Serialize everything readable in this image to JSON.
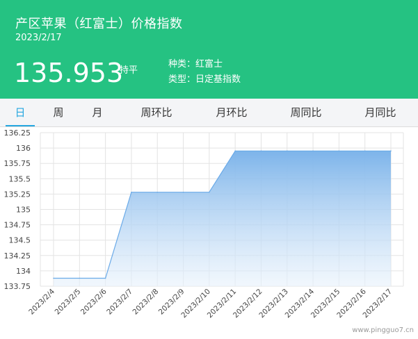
{
  "header": {
    "title": "产区苹果（红富士）价格指数",
    "date": "2023/2/17",
    "value": "135.953",
    "change": "持平",
    "variety_label": "种类：红富士",
    "type_label": "类型：日定基指数"
  },
  "tabs": [
    {
      "label": "日",
      "active": true
    },
    {
      "label": "周",
      "active": false
    },
    {
      "label": "月",
      "active": false
    },
    {
      "label": "周环比",
      "active": false
    },
    {
      "label": "月环比",
      "active": false
    },
    {
      "label": "周同比",
      "active": false
    },
    {
      "label": "月同比",
      "active": false
    }
  ],
  "watermark": "www.pingguo7.cn",
  "colors": {
    "header_bg": "#25c282",
    "active_tab": "#25a7e0",
    "line": "#6aaae8",
    "area_top": "#7db4ea"
  },
  "chart_data": {
    "type": "area",
    "x": [
      "2023/2/4",
      "2023/2/5",
      "2023/2/6",
      "2023/2/7",
      "2023/2/8",
      "2023/2/9",
      "2023/2/10",
      "2023/2/11",
      "2023/2/12",
      "2023/2/13",
      "2023/2/14",
      "2023/2/15",
      "2023/2/16",
      "2023/2/17"
    ],
    "series": [
      {
        "values": [
          133.88,
          133.88,
          133.88,
          135.28,
          135.28,
          135.28,
          135.28,
          135.953,
          135.953,
          135.953,
          135.953,
          135.953,
          135.953,
          135.953
        ]
      }
    ],
    "yticks": [
      "133.75",
      "134",
      "134.25",
      "134.5",
      "134.75",
      "135",
      "135.25",
      "135.5",
      "135.75",
      "136",
      "136.25"
    ],
    "ylim": [
      133.75,
      136.25
    ],
    "grid": true
  }
}
